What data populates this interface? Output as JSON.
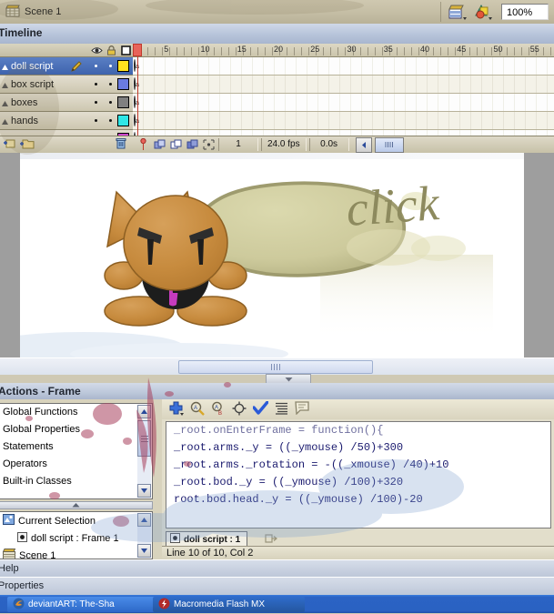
{
  "editbar": {
    "scene_name": "Scene 1",
    "edit_scene_icon": "edit-scene-icon",
    "edit_symbol_icon": "edit-symbol-icon",
    "zoom_value": "100%"
  },
  "timeline": {
    "title": "Timeline",
    "head_icons": [
      "eye-icon",
      "lock-icon",
      "outline-icon"
    ],
    "layers": [
      {
        "name": "doll script",
        "color": "#FFE21F",
        "selected": true,
        "pencil": true
      },
      {
        "name": "box script",
        "color": "#6A7BE0",
        "selected": false,
        "pencil": false
      },
      {
        "name": "boxes",
        "color": "#808080",
        "selected": false,
        "pencil": false
      },
      {
        "name": "hands",
        "color": "#2FE6E6",
        "selected": false,
        "pencil": false
      },
      {
        "name": "",
        "color": "#CC44CC",
        "selected": false,
        "pencil": false
      }
    ],
    "ruler_ticks": [
      "1",
      "5",
      "10",
      "15",
      "20",
      "25",
      "30",
      "35",
      "40",
      "45",
      "50",
      "55"
    ],
    "current_frame_marker": "1",
    "footer": {
      "new_layer_icon": "new-layer-icon",
      "new_folder_icon": "new-folder-icon",
      "delete_layer_icon": "trash-icon",
      "center_frame_icon": "center-frame-icon",
      "onion_skin_icon": "onion-skin-icon",
      "onion_outline_icon": "onion-skin-outline-icon",
      "edit_multiple_icon": "edit-multiple-frames-icon",
      "modify_markers_icon": "modify-onion-markers-icon",
      "frame_number": "1",
      "frame_rate": "24.0 fps",
      "elapsed_time": "0.0s",
      "prev_icon": "prev-frame-icon",
      "scrub_icon": "scrubber-icon"
    }
  },
  "stage": {
    "speech_bubble_text": "click",
    "character": {
      "body_color": "#C8893E",
      "torso_color": "#1c1c1c",
      "tie_color": "#C63BBD",
      "eye_color": "#2a2a2a"
    }
  },
  "scrollbar": {
    "collapse_icon": "collapse-arrow-icon",
    "thumb_grip_icon": "grip-icon"
  },
  "actions": {
    "title": "Actions - Frame",
    "toolbar": [
      "add-statement-icon",
      "find-icon",
      "replace-icon",
      "insert-target-path-icon",
      "check-syntax-icon",
      "auto-format-icon",
      "show-code-hint-icon"
    ],
    "categories": [
      "Global Functions",
      "Global Properties",
      "Statements",
      "Operators",
      "Built-in Classes"
    ],
    "tree": {
      "current_selection_label": "Current Selection",
      "current_selection_icon": "movie-clip-icon",
      "script_item": "doll script : Frame 1",
      "script_item_icon": "frame-script-icon",
      "scene_label": "Scene 1",
      "scene_icon": "scene-icon"
    },
    "code_lines": [
      "_root.onEnterFrame = function(){",
      "_root.arms._y = ((_ymouse) /50)+300",
      "_root.arms._rotation = -((_xmouse) /40)+10",
      "_root.bod._y = ((_ymouse) /100)+320",
      "root.bod.head._y = ((_ymouse) /100)-20"
    ],
    "tab_label": "doll script : 1",
    "tab_icon": "frame-script-icon",
    "pin_icon": "pin-script-icon",
    "status": "Line 10 of 10, Col 2"
  },
  "panels": {
    "help": "Help",
    "properties": "Properties"
  },
  "taskbar": {
    "items": [
      {
        "label": "deviantART: The-Sha",
        "icon": "firefox-icon"
      },
      {
        "label": "Macromedia Flash MX",
        "icon": "flash-icon"
      }
    ]
  }
}
